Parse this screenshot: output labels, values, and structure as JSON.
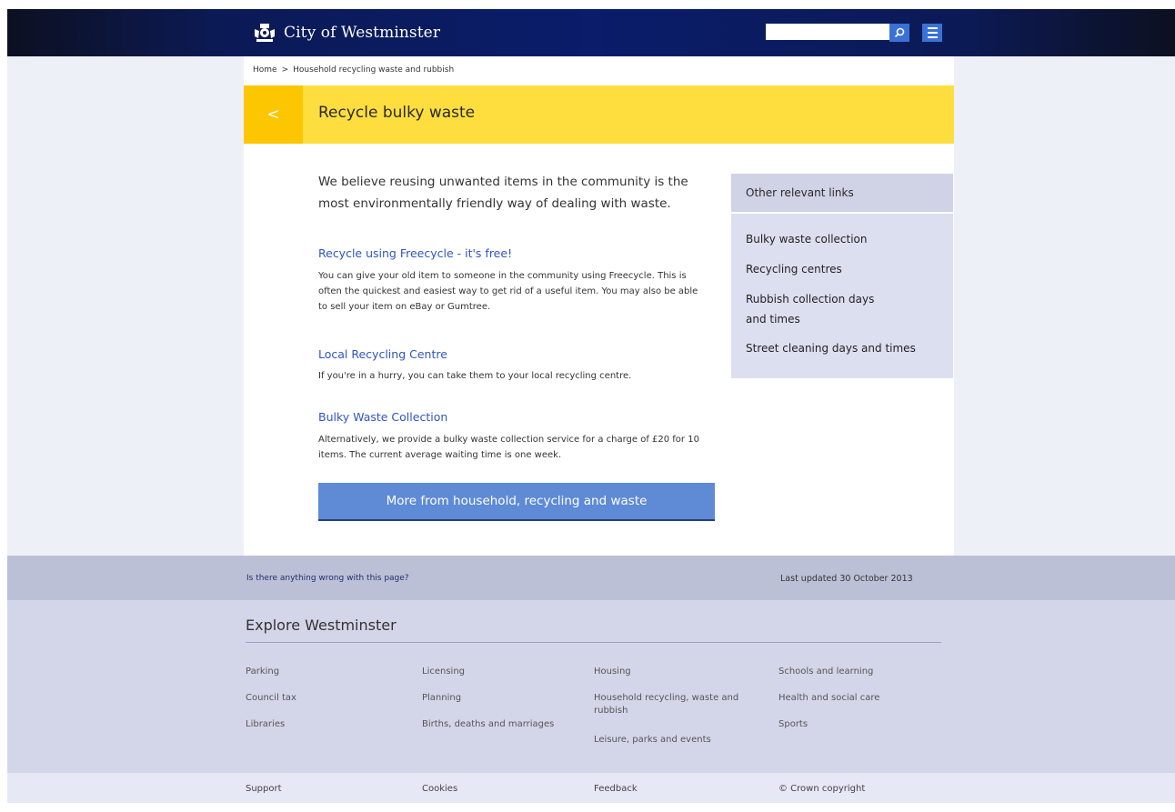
{
  "header": {
    "brand_name": "City of Westminster",
    "search_placeholder": "",
    "accent_color": "#3a71d6"
  },
  "breadcrumb": {
    "home": "Home",
    "separator": ">",
    "current": "Household recycling waste and rubbish"
  },
  "banner": {
    "back_label": "<",
    "title": "Recycle bulky waste"
  },
  "main": {
    "intro": "We believe reusing unwanted items in the community is the most environmentally friendly way of dealing with waste.",
    "sections": [
      {
        "heading": "Recycle using Freecycle - it's free!",
        "text": "You can give your old item to someone in the community using Freecycle. This is often the quickest and easiest way to get rid of a useful item. You may also be able to sell your item on eBay or Gumtree."
      },
      {
        "heading": "Local Recycling Centre",
        "text": "If you're in a hurry, you can take them to your local recycling centre."
      },
      {
        "heading": "Bulky Waste Collection",
        "text": "Alternatively, we provide a bulky waste collection service for a charge of £20 for 10 items. The current average waiting time is one week."
      }
    ],
    "more_button": "More from household, recycling and waste"
  },
  "sidebar": {
    "title": "Other relevant links",
    "links": [
      "Bulky waste collection",
      "Recycling centres",
      "Rubbish collection days and times",
      "Street cleaning days and times"
    ]
  },
  "feedback": {
    "link": "Is there anything wrong with this page?",
    "last_updated": "Last updated  30 October 2013"
  },
  "explore": {
    "title": "Explore Westminster",
    "columns": [
      [
        "Parking",
        "Council tax",
        "Libraries"
      ],
      [
        "Licensing",
        "Planning",
        "Births, deaths and marriages"
      ],
      [
        "Housing",
        "Household recycling, waste and rubbish",
        "Leisure, parks and events"
      ],
      [
        "Schools and learning",
        "Health and social care",
        "Sports"
      ]
    ]
  },
  "footer": {
    "links": [
      "Support",
      "Cookies",
      "Feedback",
      "© Crown copyright"
    ]
  }
}
